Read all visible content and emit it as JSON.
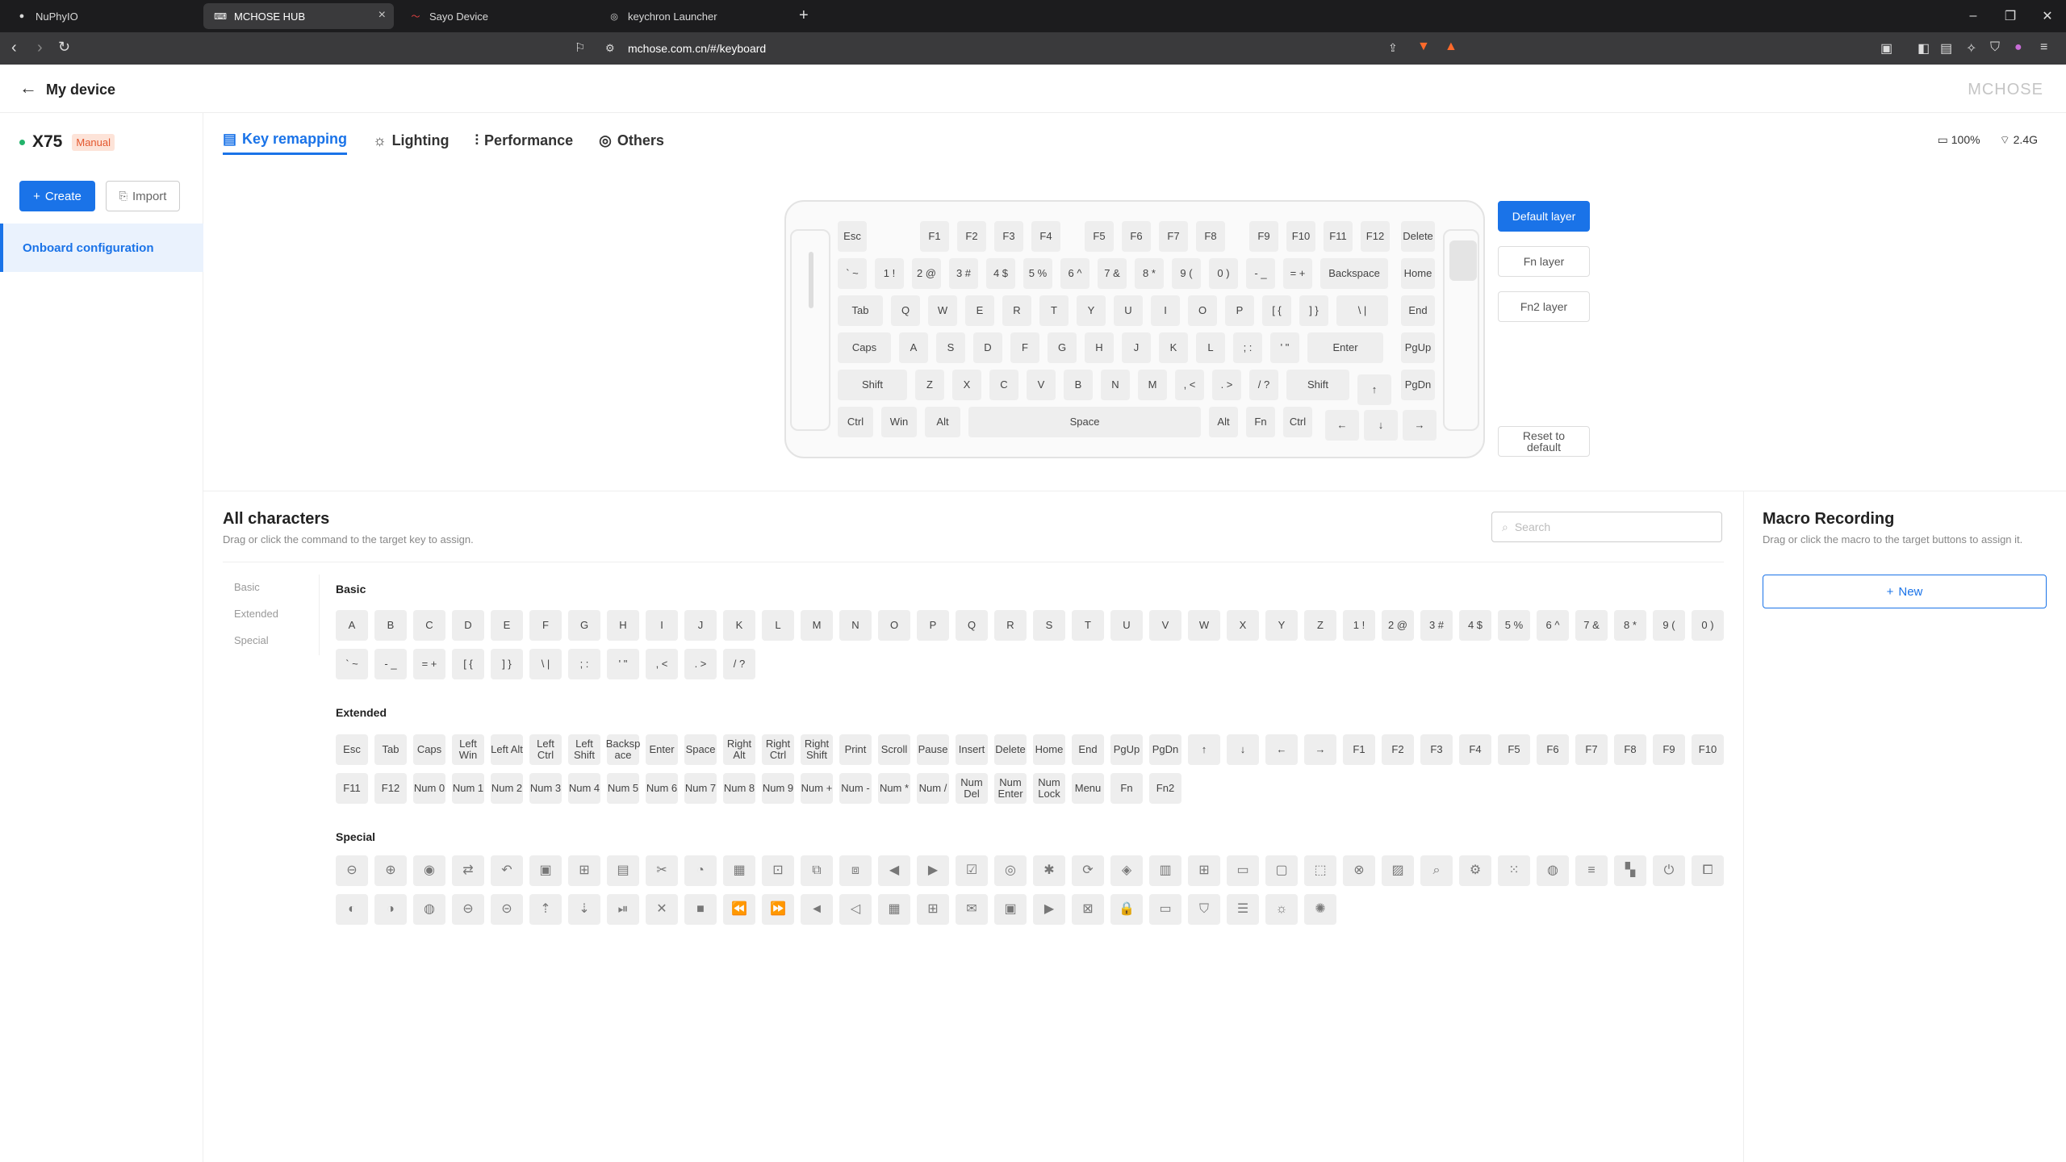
{
  "browser": {
    "tabs": [
      {
        "title": "NuPhyIO",
        "icon": "nuphy-favicon"
      },
      {
        "title": "MCHOSE HUB",
        "icon": "keyboard-favicon"
      },
      {
        "title": "Sayo Device",
        "icon": "sayo-favicon"
      },
      {
        "title": "keychron Launcher",
        "icon": "keychron-favicon"
      }
    ],
    "url": "mchose.com.cn/#/keyboard",
    "notification_count": "3"
  },
  "app": {
    "back_label": "My device",
    "brand": "MCHOSE",
    "device_name": "X75",
    "device_badge": "Manual",
    "create_label": "Create",
    "import_label": "Import",
    "config_item": "Onboard configuration",
    "tabs": [
      "Key remapping",
      "Lighting",
      "Performance",
      "Others"
    ],
    "battery": "100%",
    "connection": "2.4G"
  },
  "layers": [
    "Default layer",
    "Fn layer",
    "Fn2 layer"
  ],
  "reset_label": "Reset to default",
  "keyboard": {
    "rows": [
      [
        "Esc",
        "F1",
        "F2",
        "F3",
        "F4",
        "F5",
        "F6",
        "F7",
        "F8",
        "F9",
        "F10",
        "F11",
        "F12",
        "Delete"
      ],
      [
        "` ~",
        "1 !",
        "2 @",
        "3 #",
        "4 $",
        "5 %",
        "6 ^",
        "7 &",
        "8 *",
        "9 (",
        "0 )",
        "- _",
        "= +",
        "Backspace",
        "Home"
      ],
      [
        "Tab",
        "Q",
        "W",
        "E",
        "R",
        "T",
        "Y",
        "U",
        "I",
        "O",
        "P",
        "[ {",
        "] }",
        "\\ |",
        "End"
      ],
      [
        "Caps",
        "A",
        "S",
        "D",
        "F",
        "G",
        "H",
        "J",
        "K",
        "L",
        "; :",
        "' \"",
        "Enter",
        "PgUp"
      ],
      [
        "Shift",
        "Z",
        "X",
        "C",
        "V",
        "B",
        "N",
        "M",
        ", <",
        ". >",
        "/ ?",
        "Shift",
        "↑",
        "PgDn"
      ],
      [
        "Ctrl",
        "Win",
        "Alt",
        "Space",
        "Alt",
        "Fn",
        "Ctrl",
        "←",
        "↓",
        "→"
      ]
    ]
  },
  "all_characters": {
    "title": "All characters",
    "subtitle": "Drag or click the command to the target key to assign.",
    "search_placeholder": "Search",
    "nav": [
      "Basic",
      "Extended",
      "Special"
    ],
    "basic": {
      "label": "Basic",
      "row1": [
        "A",
        "B",
        "C",
        "D",
        "E",
        "F",
        "G",
        "H",
        "I",
        "J",
        "K",
        "L",
        "M",
        "N",
        "O",
        "P",
        "Q",
        "R",
        "S",
        "T",
        "U",
        "V",
        "W",
        "X",
        "Y",
        "Z",
        "1 !",
        "2 @",
        "3 #",
        "4 $",
        "5 %",
        "6 ^",
        "7 &",
        "8 *",
        "9 (",
        "0 )"
      ],
      "row2": [
        "` ~",
        "- _",
        "= +",
        "[ {",
        "] }",
        "\\ |",
        "; :",
        "' \"",
        ", <",
        ". >",
        "/ ?"
      ]
    },
    "extended": {
      "label": "Extended",
      "row1": [
        "Esc",
        "Tab",
        "Caps",
        "Left Win",
        "Left Alt",
        "Left Ctrl",
        "Left Shift",
        "Backsp ace",
        "Enter",
        "Space",
        "Right Alt",
        "Right Ctrl",
        "Right Shift",
        "Print",
        "Scroll",
        "Pause",
        "Insert",
        "Delete",
        "Home",
        "End",
        "PgUp",
        "PgDn",
        "↑",
        "↓",
        "←",
        "→",
        "F1",
        "F2",
        "F3",
        "F4",
        "F5",
        "F6",
        "F7",
        "F8",
        "F9",
        "F10"
      ],
      "row2": [
        "F11",
        "F12",
        "Num 0",
        "Num 1",
        "Num 2",
        "Num 3",
        "Num 4",
        "Num 5",
        "Num 6",
        "Num 7",
        "Num 8",
        "Num 9",
        "Num +",
        "Num -",
        "Num *",
        "Num /",
        "Num Del",
        "Num Enter",
        "Num Lock",
        "Menu",
        "Fn",
        "Fn2"
      ]
    },
    "special": {
      "label": "Special",
      "row1": [
        "zoom-out-icon",
        "zoom-in-icon",
        "record-icon",
        "swap-icon",
        "undo-icon",
        "clipboard-icon",
        "folder-plus-icon",
        "document-icon",
        "cut-icon",
        "pie-icon",
        "save-icon",
        "open-folder-icon",
        "copy-icon",
        "paste-icon",
        "arrow-left-icon",
        "arrow-right-icon",
        "checklist-icon",
        "eye-icon",
        "bug-icon",
        "refresh-icon",
        "box-icon",
        "calculator-icon",
        "windows-icon",
        "monitor-icon",
        "chat-icon",
        "screenshot-icon",
        "xbox-icon",
        "image-icon",
        "search-icon",
        "gear-icon",
        "grid-icon",
        "globe-icon",
        "menu-icon",
        "taskview-icon",
        "power-icon",
        "display-switch-icon"
      ],
      "row2": [
        "mouse-left-icon",
        "mouse-right-icon",
        "mouse-middle-icon",
        "mouse-back-icon",
        "mouse-forward-icon",
        "scroll-up-icon",
        "scroll-down-icon",
        "play-pause-icon",
        "mute-icon",
        "stop-icon",
        "previous-icon",
        "next-icon",
        "volume-up-icon",
        "volume-down-icon",
        "calendar-icon",
        "apps-icon",
        "mail-icon",
        "media-icon",
        "video-icon",
        "close-window-icon",
        "lock-icon",
        "computer-icon",
        "shield-icon",
        "list-icon",
        "brightness-up-icon",
        "brightness-down-icon"
      ]
    }
  },
  "macro": {
    "title": "Macro Recording",
    "subtitle": "Drag or click the macro to the target buttons to assign it.",
    "new_label": "New"
  },
  "colors": {
    "accent": "#1a73e8",
    "badge": "#e4572e",
    "key_bg": "#eeeeee"
  }
}
